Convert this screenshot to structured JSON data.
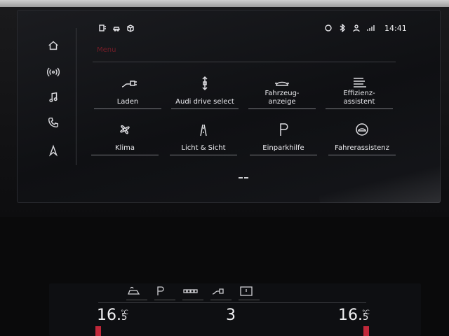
{
  "status": {
    "time": "14:41"
  },
  "title": "Menu",
  "tiles": [
    {
      "label": "Laden",
      "icon": "charging-plug-icon"
    },
    {
      "label": "Audi drive select",
      "label2": "select",
      "icon": "drive-select-icon"
    },
    {
      "label": "Fahrzeug-",
      "label2": "anzeige",
      "icon": "vehicle-status-icon"
    },
    {
      "label": "Effizienz-",
      "label2": "assistent",
      "icon": "efficiency-assistant-icon"
    },
    {
      "label": "Klima",
      "icon": "fan-icon"
    },
    {
      "label": "Licht & Sicht",
      "icon": "road-lights-icon"
    },
    {
      "label": "Einparkhilfe",
      "icon": "parking-p-icon"
    },
    {
      "label": "Fahrerassistenz",
      "icon": "driver-assist-icon"
    }
  ],
  "nav": [
    "home-icon",
    "radio-icon",
    "music-note-icon",
    "phone-icon",
    "navigation-arrow-icon"
  ],
  "climate": {
    "left_temp_main": "16.",
    "left_temp_dec": "5",
    "right_temp_main": "16.",
    "right_temp_dec": "5",
    "unit": "°C",
    "fan_level": "3"
  }
}
